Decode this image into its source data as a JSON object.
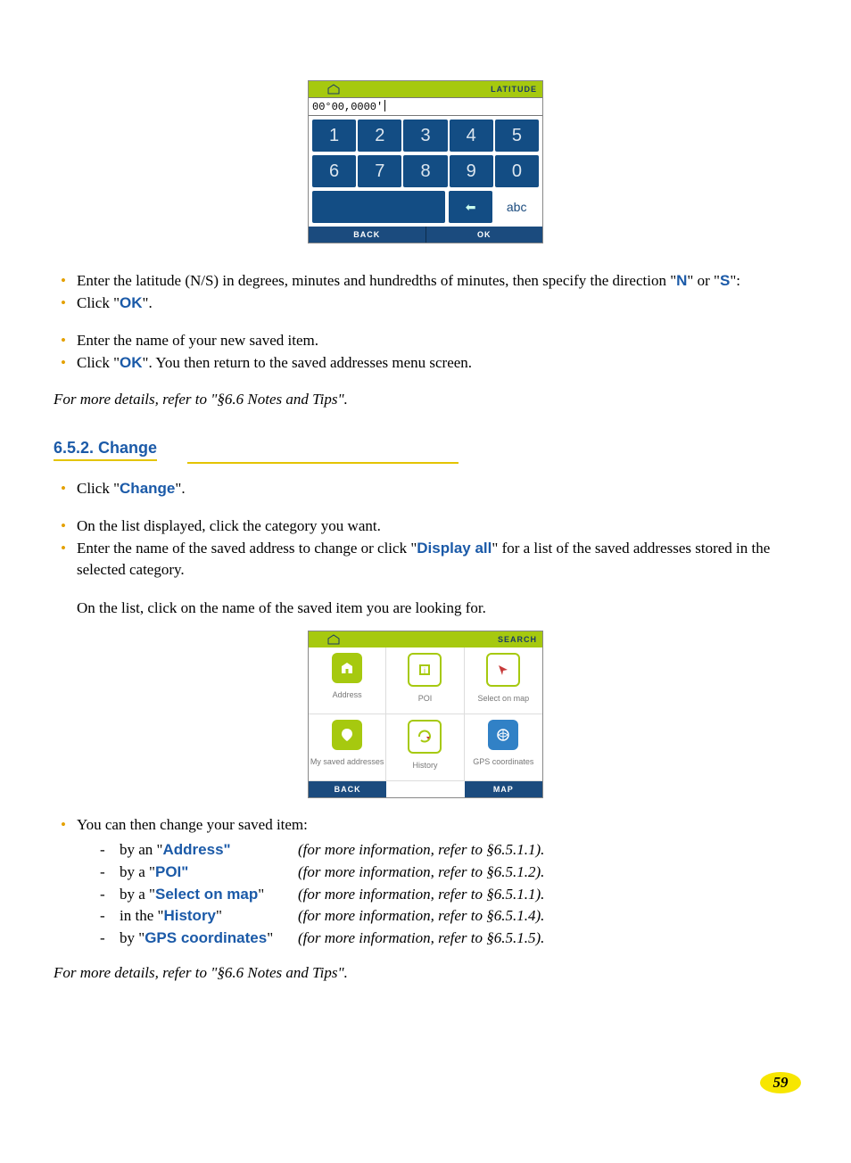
{
  "keypad": {
    "title": "LATITUDE",
    "input_value": "00°00,0000'",
    "row1": [
      "1",
      "2",
      "3",
      "4",
      "5"
    ],
    "row2": [
      "6",
      "7",
      "8",
      "9",
      "0"
    ],
    "backspace_glyph": "⬅",
    "abc_label": "abc",
    "back_label": "BACK",
    "ok_label": "OK"
  },
  "block1": {
    "li1_a": "Enter the latitude (N/S) in degrees, minutes and hundredths of minutes, then specify the direction \"",
    "li1_N": "N",
    "li1_mid": "\" or \"",
    "li1_S": "S",
    "li1_end": "\":",
    "li2_a": "Click \"",
    "li2_OK": "OK",
    "li2_end": "\"."
  },
  "block2": {
    "li1": "Enter the name of your new saved item.",
    "li2_a": "Click \"",
    "li2_OK": "OK",
    "li2_end": "\". You then return to the saved addresses menu screen."
  },
  "note1": "For more details, refer to \"§6.6 Notes and Tips\".",
  "heading": "6.5.2. Change",
  "block3": {
    "li1_a": "Click \"",
    "li1_Change": "Change",
    "li1_end": "\"."
  },
  "block4": {
    "li1": "On the list displayed, click the category you want.",
    "li2_a": "Enter the name of the saved address to change or click \"",
    "li2_DisplayAll": "Display all",
    "li2_end": "\" for a list of the saved addresses stored in the selected category.",
    "para": "On the list, click on the name of the saved item you are looking for."
  },
  "search": {
    "title": "SEARCH",
    "cells": [
      {
        "label": "Address",
        "color": "#a6c90f"
      },
      {
        "label": "POI",
        "color": "#a6c90f"
      },
      {
        "label": "Select on map",
        "color": "#3181c6"
      },
      {
        "label": "My saved addresses",
        "color": "#a6c90f"
      },
      {
        "label": "History",
        "color": "#a6c90f"
      },
      {
        "label": "GPS coordinates",
        "color": "#3181c6"
      }
    ],
    "back_label": "BACK",
    "map_label": "MAP"
  },
  "block5": {
    "intro": "You can then change your saved item:",
    "rows": [
      {
        "pre": "by an \"",
        "bold": "Address\"",
        "info": "(for more information, refer to §6.5.1.1)."
      },
      {
        "pre": "by a \"",
        "bold": "POI\"",
        "info": "(for more information, refer to §6.5.1.2)."
      },
      {
        "pre": "by a \"",
        "bold": "Select on map",
        "post": "\"",
        "info": "(for more information, refer to §6.5.1.1)."
      },
      {
        "pre": "in the \"",
        "bold": "History",
        "post": "\"",
        "info": "(for more information, refer to §6.5.1.4)."
      },
      {
        "pre": "by \"",
        "bold": "GPS coordinates",
        "post": "\"",
        "info": "(for more information, refer to §6.5.1.5)."
      }
    ]
  },
  "note2": "For more details, refer to \"§6.6 Notes and Tips\".",
  "page_number": "59"
}
